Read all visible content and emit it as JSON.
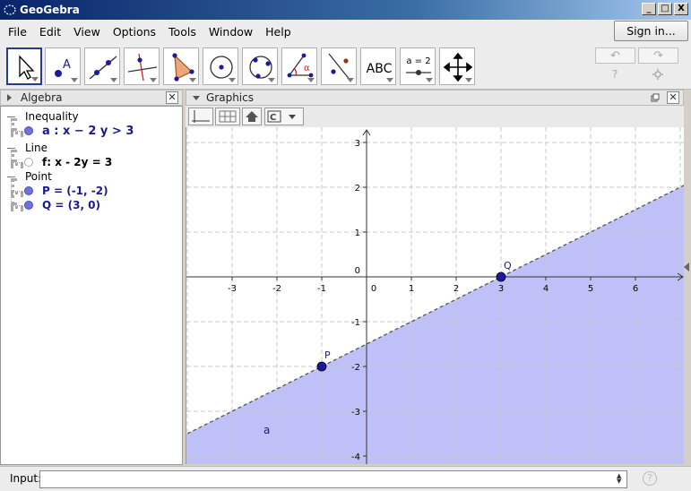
{
  "window": {
    "title": "GeoGebra",
    "controls": [
      "_",
      "□",
      "X"
    ]
  },
  "menu": {
    "items": [
      "File",
      "Edit",
      "View",
      "Options",
      "Tools",
      "Window",
      "Help"
    ],
    "signin_label": "Sign in..."
  },
  "toolbar": {
    "tools": [
      {
        "icon": "move-pointer-icon"
      },
      {
        "icon": "new-point-icon"
      },
      {
        "icon": "line-through-points-icon"
      },
      {
        "icon": "perpendicular-line-icon"
      },
      {
        "icon": "polygon-icon"
      },
      {
        "icon": "circle-center-point-icon"
      },
      {
        "icon": "circle-three-points-icon"
      },
      {
        "icon": "angle-icon"
      },
      {
        "icon": "reflect-about-line-icon"
      },
      {
        "icon": "text-icon",
        "label": "ABC"
      },
      {
        "icon": "slider-icon",
        "label": "a = 2"
      },
      {
        "icon": "move-graphics-view-icon"
      }
    ],
    "undo_glyph": "↶",
    "redo_glyph": "↷",
    "help_glyph": "?",
    "settings_icon": "gear-icon"
  },
  "algebra": {
    "title": "Algebra",
    "categories": [
      {
        "name": "Inequality",
        "items": [
          {
            "text": "a :  x − 2 y > 3",
            "shown": true
          }
        ]
      },
      {
        "name": "Line",
        "items": [
          {
            "text": "f: x - 2y = 3",
            "shown": false
          }
        ]
      },
      {
        "name": "Point",
        "items": [
          {
            "text": "P = (-1, -2)",
            "shown": true
          },
          {
            "text": "Q = (3, 0)",
            "shown": true
          }
        ]
      }
    ]
  },
  "graphics": {
    "title": "Graphics",
    "axes": {
      "x_ticks": [
        -3,
        -2,
        -1,
        0,
        1,
        2,
        3,
        4,
        5,
        6
      ],
      "y_ticks": [
        -4,
        -3,
        -2,
        -1,
        1,
        2,
        3
      ],
      "xlim": [
        -4,
        7
      ],
      "ylim": [
        -4.2,
        3.3
      ]
    },
    "inequality": {
      "label": "a",
      "label_pos": [
        -2.3,
        -3.5
      ],
      "fill_color": "#b9b9f7",
      "boundary_color": "#555555"
    },
    "points": [
      {
        "name": "P",
        "x": -1,
        "y": -2
      },
      {
        "name": "Q",
        "x": 3,
        "y": 0
      }
    ],
    "point_color": "#1a1aa0"
  },
  "input": {
    "label": "Input:",
    "value": "",
    "help_glyph": "?"
  }
}
